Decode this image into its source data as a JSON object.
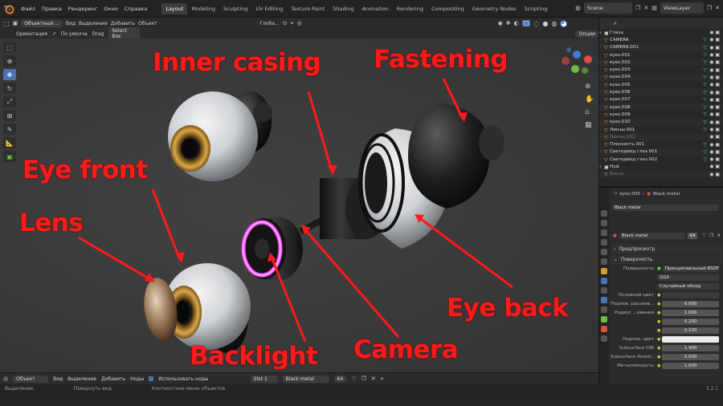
{
  "menu": [
    "Файл",
    "Правка",
    "Рендеринг",
    "Окно",
    "Справка"
  ],
  "workspaces": [
    {
      "label": "Layout",
      "active": true
    },
    {
      "label": "Modeling",
      "active": false
    },
    {
      "label": "Sculpting",
      "active": false
    },
    {
      "label": "UV Editing",
      "active": false
    },
    {
      "label": "Texture Paint",
      "active": false
    },
    {
      "label": "Shading",
      "active": false
    },
    {
      "label": "Animation",
      "active": false
    },
    {
      "label": "Rendering",
      "active": false
    },
    {
      "label": "Compositing",
      "active": false
    },
    {
      "label": "Geometry Nodes",
      "active": false
    },
    {
      "label": "Scripting",
      "active": false
    }
  ],
  "topright": {
    "scene": "Scene",
    "view_layer": "ViewLayer"
  },
  "viewport_header": {
    "mode": "Объектный ...",
    "view": "Вид",
    "select": "Выделение",
    "add": "Добавить",
    "object": "Объект",
    "transform": "Глоба...",
    "options": "Опции"
  },
  "viewport_header2": {
    "orientation_label": "Ориентация",
    "orientation_value": "По умолча",
    "drag_label": "Drag",
    "drag_value": "Select Box"
  },
  "annotations": {
    "inner_casing": "Inner casing",
    "fastening": "Fastening",
    "eye_front": "Eye front",
    "lens": "Lens",
    "backlight": "Backlight",
    "camera": "Camera",
    "eye_back": "Eye back"
  },
  "outliner": {
    "collection": "Глаза",
    "items": [
      {
        "name": "CAMERA",
        "dim": false,
        "green": true
      },
      {
        "name": "CAMERA.001",
        "dim": false,
        "green": true
      },
      {
        "name": "eyes.001",
        "dim": false,
        "green": true
      },
      {
        "name": "eyes.002",
        "dim": false,
        "green": true
      },
      {
        "name": "eyes.003",
        "dim": false,
        "green": true
      },
      {
        "name": "eyes.004",
        "dim": false,
        "green": true
      },
      {
        "name": "eyes.005",
        "dim": false,
        "green": true
      },
      {
        "name": "eyes.006",
        "dim": false,
        "green": true
      },
      {
        "name": "eyes.007",
        "dim": false,
        "green": true
      },
      {
        "name": "eyes.008",
        "dim": false,
        "green": true
      },
      {
        "name": "eyes.009",
        "dim": false,
        "green": true
      },
      {
        "name": "eyes.010",
        "dim": false,
        "green": true
      },
      {
        "name": "Линзы.001",
        "dim": false,
        "green": true
      },
      {
        "name": "Линзы.002",
        "dim": true,
        "green": false
      },
      {
        "name": "Плоскость.001",
        "dim": false,
        "green": true
      },
      {
        "name": "Светодиод глаз.001",
        "dim": false,
        "green": true
      },
      {
        "name": "Светодиод глаз.002",
        "dim": false,
        "green": true
      }
    ],
    "collection2": "Hud",
    "collection2_item": "Весна"
  },
  "properties": {
    "breadcrumb_obj": "eyes.005",
    "breadcrumb_mat": "Black metal",
    "slot_material": "Black metal",
    "material_name": "Black metal",
    "users": "64",
    "preview": "Предпросмотр",
    "surface_section": "Поверхность",
    "surface_label": "Поверхность",
    "surface_value": "Принципиальный BSDF",
    "distribution": "GGX",
    "subsurface_method": "Случайный обход",
    "rows": [
      {
        "label": "Основной цвет",
        "value": "",
        "style": "dark"
      },
      {
        "label": "Подпов. рассеив...",
        "value": "0.000",
        "style": "normal"
      },
      {
        "label": "Радиус ...ивания",
        "value": "1.000",
        "style": "normal"
      },
      {
        "label": "",
        "value": "0.200",
        "style": "normal"
      },
      {
        "label": "",
        "value": "0.100",
        "style": "normal"
      },
      {
        "label": "Подпов. цвет",
        "value": "",
        "style": "white"
      },
      {
        "label": "Subsurface IOR",
        "value": "1.400",
        "style": "normal"
      },
      {
        "label": "Subsurface Anisot...",
        "value": "0.000",
        "style": "normal"
      },
      {
        "label": "Металличность",
        "value": "1.000",
        "style": "normal"
      }
    ]
  },
  "timeline": {
    "mode": "Объект",
    "view": "Вид",
    "select": "Выделение",
    "add": "Добавить",
    "nodes": "Ноды",
    "use_nodes": "Использовать ноды",
    "slot": "Slot 1",
    "material": "Black metal",
    "users": "64"
  },
  "statusbar": {
    "select": "Выделение",
    "rotate": "Повернуть вид",
    "context": "Контекстное меню объектов",
    "version": "3.2.1"
  },
  "colors": {
    "annotation": "#ff1a1a",
    "accent": "#4a72b5",
    "outliner_icon": "#f29d39"
  }
}
